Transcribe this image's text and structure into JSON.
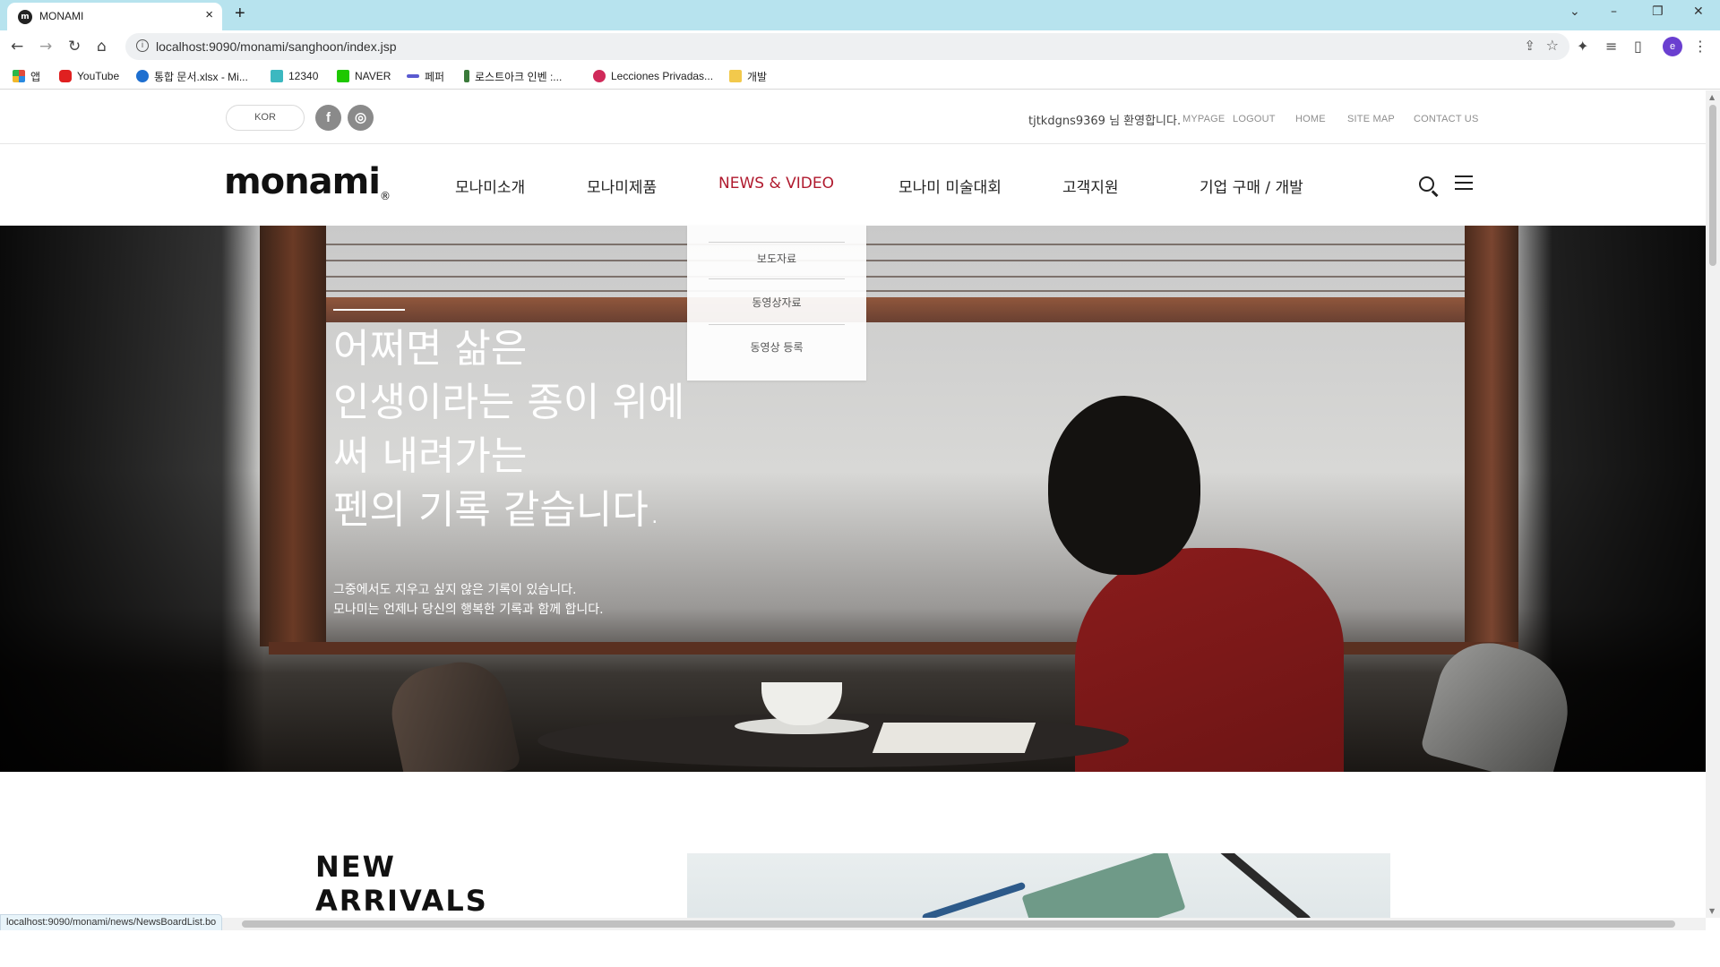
{
  "browser": {
    "tab_title": "MONAMI",
    "tab_favicon": "m",
    "tab_close": "×",
    "new_tab": "+",
    "url": "localhost:9090/monami/sanghoon/index.jsp",
    "profile_initial": "e",
    "bookmarks": [
      {
        "label": "앱",
        "icon": "apps-grid-icon",
        "color": "#e04a3a"
      },
      {
        "label": "YouTube",
        "icon": "youtube-icon",
        "color": "#e02020"
      },
      {
        "label": "통합 문서.xlsx - Mi...",
        "icon": "onedrive-icon",
        "color": "#1e6fd0"
      },
      {
        "label": "12340",
        "icon": "teal-square-icon",
        "color": "#3cb8c0"
      },
      {
        "label": "NAVER",
        "icon": "naver-icon",
        "color": "#1ec800"
      },
      {
        "label": "페퍼",
        "icon": "pepper-icon",
        "color": "#5a5ad0"
      },
      {
        "label": "로스트아크 인벤 :...",
        "icon": "inven-icon",
        "color": "#3a7a3a"
      },
      {
        "label": "Lecciones Privadas...",
        "icon": "star-badge-icon",
        "color": "#d02a5a"
      },
      {
        "label": "개발",
        "icon": "folder-icon",
        "color": "#f2c94c"
      }
    ],
    "status_url": "localhost:9090/monami/news/NewsBoardList.bo"
  },
  "topbar": {
    "lang": "KOR",
    "social": [
      {
        "glyph": "f",
        "icon": "facebook-icon"
      },
      {
        "glyph": "◎",
        "icon": "instagram-icon"
      }
    ],
    "welcome": "tjtkdgns9369 님 환영합니다.",
    "links": [
      "MYPAGE",
      "LOGOUT",
      "HOME",
      "SITE MAP",
      "CONTACT US"
    ]
  },
  "gnb": {
    "logo": "monami",
    "logo_mark": "®",
    "items": [
      "모나미소개",
      "모나미제품",
      "NEWS & VIDEO",
      "모나미 미술대회",
      "고객지원",
      "기업 구매 / 개발"
    ],
    "active_index": 2,
    "dropdown": [
      "보도자료",
      "동영상자료",
      "동영상 등록"
    ]
  },
  "hero": {
    "title_lines": [
      "어쩌면 삶은",
      "인생이라는 종이 위에",
      "써 내려가는",
      "펜의 기록 같습니다."
    ],
    "sub_lines": [
      "그중에서도 지우고 싶지 않은 기록이 있습니다.",
      "모나미는 언제나 당신의 행복한 기록과 함께 합니다."
    ]
  },
  "new_arrivals": {
    "title_lines": [
      "NEW",
      "ARRIVALS"
    ]
  },
  "colors": {
    "accent": "#b01a2e",
    "tabbar": "#b7e3ee"
  }
}
